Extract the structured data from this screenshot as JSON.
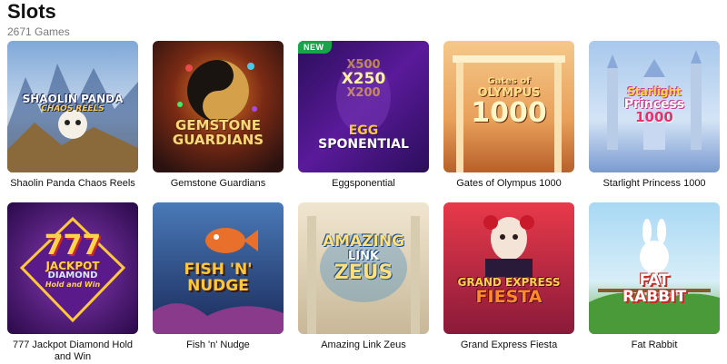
{
  "header": {
    "title": "Slots",
    "count": "2671 Games"
  },
  "games": [
    {
      "name": "Shaolin Panda Chaos Reels",
      "logo_lines": [
        "SHAOLIN PANDA",
        "CHAOS REELS"
      ],
      "colors": [
        "#9ec4e8",
        "#5a7fb5",
        "#c9a77a"
      ],
      "badge": ""
    },
    {
      "name": "Gemstone Guardians",
      "logo_lines": [
        "GEMSTONE",
        "GUARDIANS"
      ],
      "colors": [
        "#3a1e14",
        "#7a3a18",
        "#d86a1e"
      ],
      "badge": ""
    },
    {
      "name": "Eggsponential",
      "logo_lines": [
        "X500",
        "X250",
        "X200",
        "EGG",
        "SPONENTIAL"
      ],
      "colors": [
        "#4a1a8a",
        "#2a0e5a",
        "#8a2ac0"
      ],
      "badge": "NEW"
    },
    {
      "name": "Gates of Olympus 1000",
      "logo_lines": [
        "Gates of",
        "OLYMPUS",
        "1000"
      ],
      "colors": [
        "#e89a4a",
        "#f5c27a",
        "#c86a2a"
      ],
      "badge": ""
    },
    {
      "name": "Starlight Princess 1000",
      "logo_lines": [
        "Starlight",
        "Princess",
        "1000"
      ],
      "colors": [
        "#8ab8e8",
        "#c8daf0",
        "#6a8ac8"
      ],
      "badge": ""
    },
    {
      "name": "777 Jackpot Diamond Hold and Win",
      "logo_lines": [
        "777",
        "JACKPOT",
        "DIAMOND",
        "Hold and Win"
      ],
      "colors": [
        "#5a1a7a",
        "#2a0a4a",
        "#8a3aaa"
      ],
      "badge": ""
    },
    {
      "name": "Fish 'n' Nudge",
      "logo_lines": [
        "FISH 'N'",
        "NUDGE"
      ],
      "colors": [
        "#2a6a9a",
        "#1a3a6a",
        "#4a9ac8"
      ],
      "badge": ""
    },
    {
      "name": "Amazing Link Zeus",
      "logo_lines": [
        "AMAZING",
        "LINK",
        "ZEUS"
      ],
      "colors": [
        "#e8dcc4",
        "#cfc3a8",
        "#a89878"
      ],
      "badge": ""
    },
    {
      "name": "Grand Express Fiesta",
      "logo_lines": [
        "GRAND EXPRESS",
        "FIESTA"
      ],
      "colors": [
        "#c82a2a",
        "#8a1a3a",
        "#e85a3a"
      ],
      "badge": ""
    },
    {
      "name": "Fat Rabbit",
      "logo_lines": [
        "FAT",
        "RABBIT"
      ],
      "colors": [
        "#a8d4f0",
        "#6ab84a",
        "#3a8a3a"
      ],
      "badge": ""
    }
  ]
}
